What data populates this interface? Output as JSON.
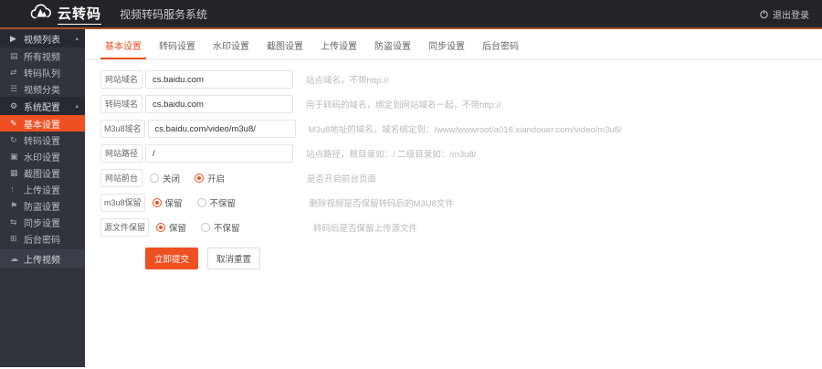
{
  "colors": {
    "accent": "#ef5022",
    "topbar_bg": "#222429",
    "sidebar_bg": "#31343d",
    "accent_line": "#a8502a"
  },
  "topbar": {
    "logo_text": "云转码",
    "app_title": "视频转码服务系统",
    "logout_label": "退出登录"
  },
  "sidebar": {
    "items": [
      {
        "label": "视频列表",
        "type": "header",
        "icon": "video-list-icon",
        "glyph": "▶",
        "caret": "▴"
      },
      {
        "label": "所有视频",
        "type": "item",
        "icon": "all-videos-icon",
        "glyph": "▤"
      },
      {
        "label": "转码队列",
        "type": "item",
        "icon": "queue-icon",
        "glyph": "⇄"
      },
      {
        "label": "视频分类",
        "type": "item",
        "icon": "category-icon",
        "glyph": "☰"
      },
      {
        "label": "系统配置",
        "type": "header",
        "icon": "gear-icon",
        "glyph": "⚙",
        "caret": "▴"
      },
      {
        "label": "基本设置",
        "type": "item",
        "active": true,
        "icon": "edit-icon",
        "glyph": "✎"
      },
      {
        "label": "转码设置",
        "type": "item",
        "icon": "refresh-icon",
        "glyph": "↻"
      },
      {
        "label": "水印设置",
        "type": "item",
        "icon": "watermark-icon",
        "glyph": "▣"
      },
      {
        "label": "截图设置",
        "type": "item",
        "icon": "image-icon",
        "glyph": "▦"
      },
      {
        "label": "上传设置",
        "type": "item",
        "icon": "upload-icon",
        "glyph": "↑"
      },
      {
        "label": "防盗设置",
        "type": "item",
        "icon": "flag-icon",
        "glyph": "⚑"
      },
      {
        "label": "同步设置",
        "type": "item",
        "icon": "sync-icon",
        "glyph": "⇆"
      },
      {
        "label": "后台密码",
        "type": "item",
        "icon": "password-icon",
        "glyph": "⊞"
      },
      {
        "label": "上传视频",
        "type": "upload",
        "icon": "cloud-upload-icon",
        "glyph": "☁"
      }
    ]
  },
  "tabs": [
    {
      "label": "基本设置",
      "active": true
    },
    {
      "label": "转码设置"
    },
    {
      "label": "水印设置"
    },
    {
      "label": "截图设置"
    },
    {
      "label": "上传设置"
    },
    {
      "label": "防盗设置"
    },
    {
      "label": "同步设置"
    },
    {
      "label": "后台密码"
    }
  ],
  "form": {
    "rows": [
      {
        "label": "网站域名",
        "type": "text",
        "value": "cs.baidu.com",
        "hint": "站点域名，不带http://"
      },
      {
        "label": "转码域名",
        "type": "text",
        "value": "cs.baidu.com",
        "hint": "用于转码的域名，绑定到网站域名一起，不带http://"
      },
      {
        "label": "M3u8域名",
        "type": "text",
        "value": "cs.baidu.com/video/m3u8/",
        "hint": "M3u8地址的域名，域名绑定到：/www/wwwroot/a016.xiandouer.com/video/m3u8/"
      },
      {
        "label": "网站路径",
        "type": "text",
        "value": "/",
        "hint": "站点路径，根目录如：/ 二级目录如：/m3u8/"
      },
      {
        "label": "网站前台",
        "type": "radio",
        "options": [
          {
            "label": "关闭",
            "selected": false
          },
          {
            "label": "开启",
            "selected": true
          }
        ],
        "hint": "是否开启前台页面"
      },
      {
        "label": "m3u8保留",
        "type": "radio",
        "options": [
          {
            "label": "保留",
            "selected": true
          },
          {
            "label": "不保留",
            "selected": false
          }
        ],
        "hint": "删除视频是否保留转码后的M3U8文件"
      },
      {
        "label": "源文件保留",
        "type": "radio",
        "options": [
          {
            "label": "保留",
            "selected": true
          },
          {
            "label": "不保留",
            "selected": false
          }
        ],
        "hint": "转码后是否保留上传源文件"
      }
    ],
    "submit_label": "立即提交",
    "reset_label": "取消重置"
  }
}
